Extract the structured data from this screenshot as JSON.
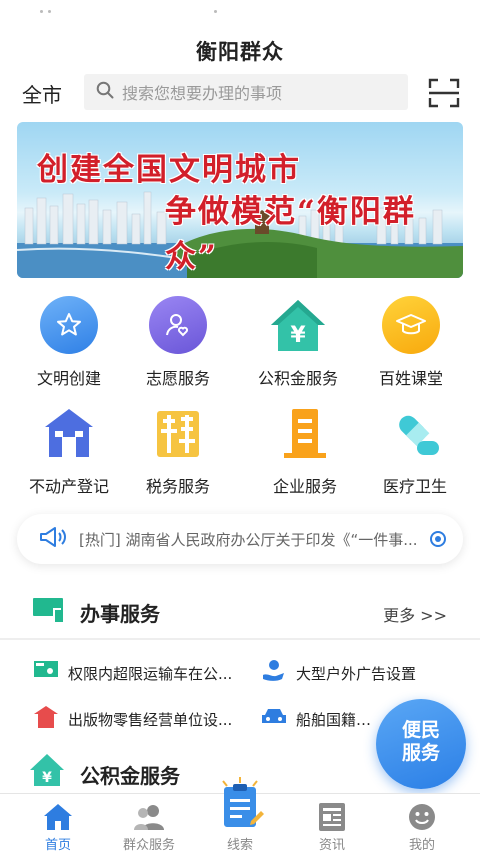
{
  "header": {
    "app_title": "衡阳群众",
    "city": "全市",
    "search_placeholder": "搜索您想要办理的事项"
  },
  "banner": {
    "line1": "创建全国文明城市",
    "line2": "争做模范“衡阳群众”"
  },
  "quick_grid": [
    {
      "label": "文明创建",
      "icon": "star-icon"
    },
    {
      "label": "志愿服务",
      "icon": "volunteer-icon"
    },
    {
      "label": "公积金服务",
      "icon": "yuan-house-icon"
    },
    {
      "label": "百姓课堂",
      "icon": "graduation-cap-icon"
    },
    {
      "label": "不动产登记",
      "icon": "building-icon"
    },
    {
      "label": "税务服务",
      "icon": "tax-icon"
    },
    {
      "label": "企业服务",
      "icon": "office-building-icon"
    },
    {
      "label": "医疗卫生",
      "icon": "pill-icon"
    }
  ],
  "notice": {
    "text": "[热门] 湖南省人民政府办公厅关于印发《“一件事..."
  },
  "section_office": {
    "title": "办事服务",
    "more": "更多 >>",
    "items": [
      {
        "label": "权限内超限运输车在公...",
        "icon": "truck-icon"
      },
      {
        "label": "大型户外广告设置",
        "icon": "hand-user-icon"
      },
      {
        "label": "出版物零售经营单位设...",
        "icon": "store-icon"
      },
      {
        "label": "船舶国籍证书",
        "icon": "car-icon"
      }
    ]
  },
  "section_fund": {
    "title": "公积金服务"
  },
  "fab": {
    "line1": "便民",
    "line2": "服务"
  },
  "tabs": [
    {
      "label": "首页",
      "icon": "home-icon",
      "active": true
    },
    {
      "label": "群众服务",
      "icon": "people-icon",
      "active": false
    },
    {
      "label": "线索",
      "icon": "clipboard-icon",
      "active": false
    },
    {
      "label": "资讯",
      "icon": "news-icon",
      "active": false
    },
    {
      "label": "我的",
      "icon": "smile-icon",
      "active": false
    }
  ],
  "colors": {
    "accent": "#2e7de0",
    "teal": "#21b88f",
    "banner_text": "#d21f2a"
  }
}
